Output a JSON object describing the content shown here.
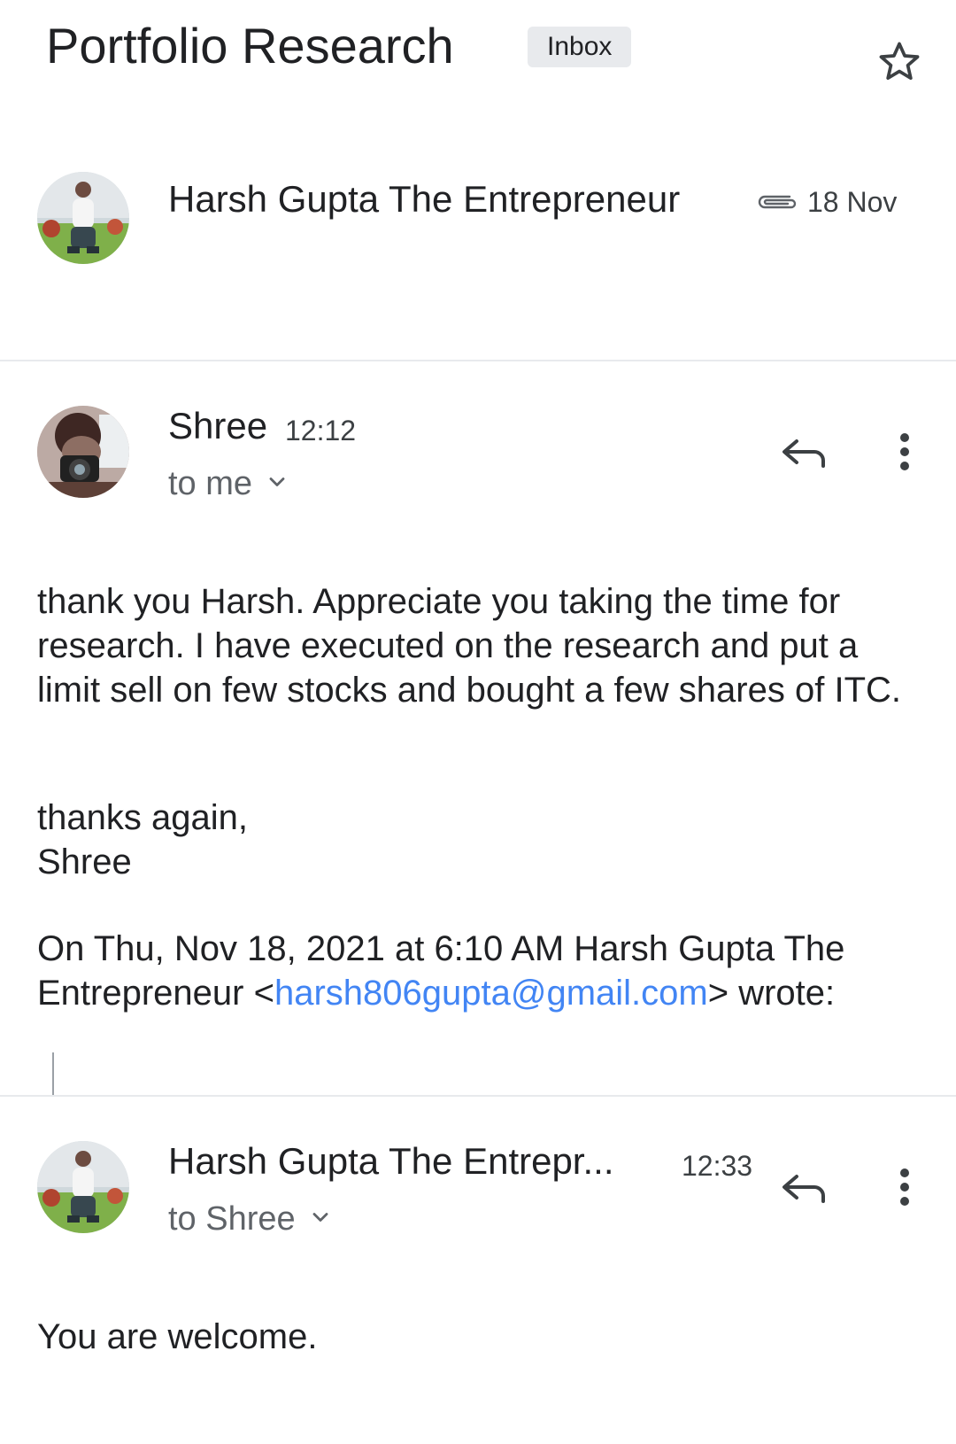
{
  "thread": {
    "subject": "Portfolio Research",
    "label": "Inbox"
  },
  "icons": {
    "star": "star-outline-icon",
    "attachment": "paperclip-icon",
    "reply": "reply-arrow-icon",
    "more": "more-vert-icon",
    "expand": "chevron-down-icon"
  },
  "colors": {
    "link": "#4285f4",
    "secondary_text": "#5f6368",
    "divider": "#e8eaed",
    "chip_bg": "#e8eaed"
  },
  "collapsed_message": {
    "sender": "Harsh Gupta The Entrepreneur",
    "date": "18 Nov",
    "has_attachment": true
  },
  "message_1": {
    "sender": "Shree",
    "time": "12:12",
    "recipient": "to me",
    "body_para_1": "thank you Harsh. Appreciate you taking the time for research. I have executed on the research and put a limit sell on few stocks and bought a few shares of ITC.",
    "signoff_line_1": "thanks again,",
    "signoff_line_2": "Shree",
    "quote_header_prefix": "On Thu, Nov 18, 2021 at 6:10 AM Harsh Gupta The Entrepreneur <",
    "quote_email": "harsh806gupta@gmail.com",
    "quote_header_suffix": "> wrote:"
  },
  "message_2": {
    "sender": "Harsh Gupta The Entrepr...",
    "time": "12:33",
    "recipient": "to Shree",
    "body": "You are welcome."
  }
}
